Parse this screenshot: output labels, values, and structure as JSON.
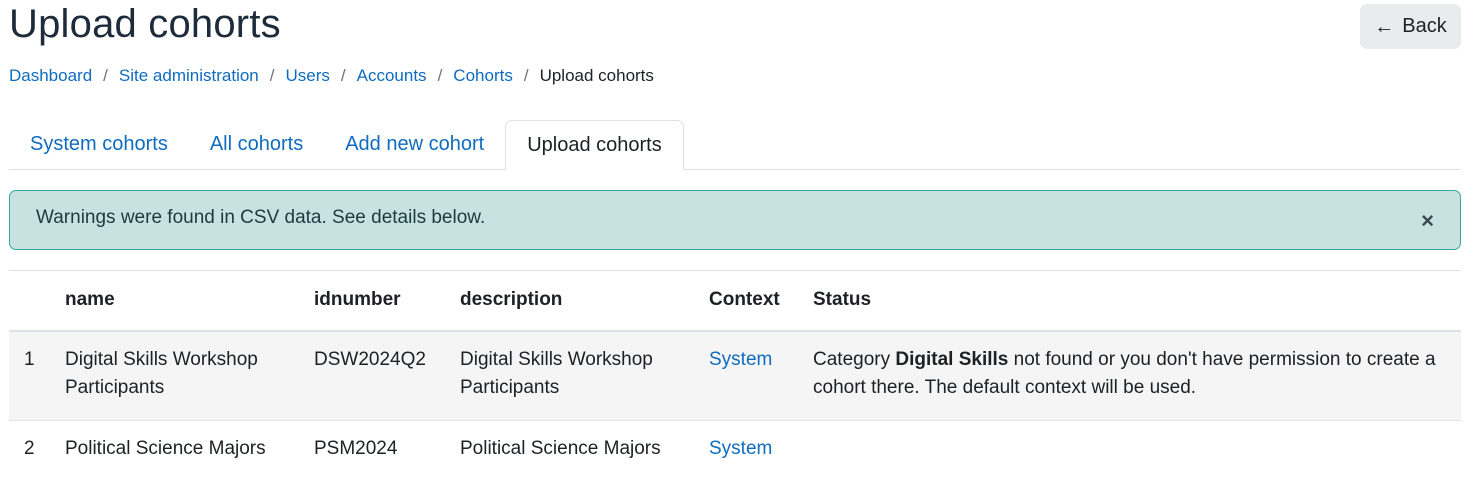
{
  "header": {
    "title": "Upload cohorts",
    "back_label": "Back"
  },
  "breadcrumb": [
    {
      "label": "Dashboard"
    },
    {
      "label": "Site administration"
    },
    {
      "label": "Users"
    },
    {
      "label": "Accounts"
    },
    {
      "label": "Cohorts"
    },
    {
      "label": "Upload cohorts"
    }
  ],
  "tabs": [
    {
      "label": "System cohorts"
    },
    {
      "label": "All cohorts"
    },
    {
      "label": "Add new cohort"
    },
    {
      "label": "Upload cohorts"
    }
  ],
  "alert": {
    "message": "Warnings were found in CSV data. See details below.",
    "close_symbol": "×"
  },
  "table": {
    "columns": [
      "",
      "name",
      "idnumber",
      "description",
      "Context",
      "Status"
    ],
    "rows": [
      {
        "num": "1",
        "name": "Digital Skills Workshop Participants",
        "idnumber": "DSW2024Q2",
        "description": "Digital Skills Workshop Participants",
        "context": "System",
        "status_prefix": "Category ",
        "status_bold": "Digital Skills",
        "status_suffix": " not found or you don't have permission to create a cohort there. The default context will be used."
      },
      {
        "num": "2",
        "name": "Political Science Majors",
        "idnumber": "PSM2024",
        "description": "Political Science Majors",
        "context": "System",
        "status_prefix": "",
        "status_bold": "",
        "status_suffix": ""
      }
    ]
  },
  "colors": {
    "link": "#0f6cbf",
    "alert_bg": "#c7e2e1",
    "alert_border": "#36a6a0",
    "title": "#1d2b3a"
  }
}
